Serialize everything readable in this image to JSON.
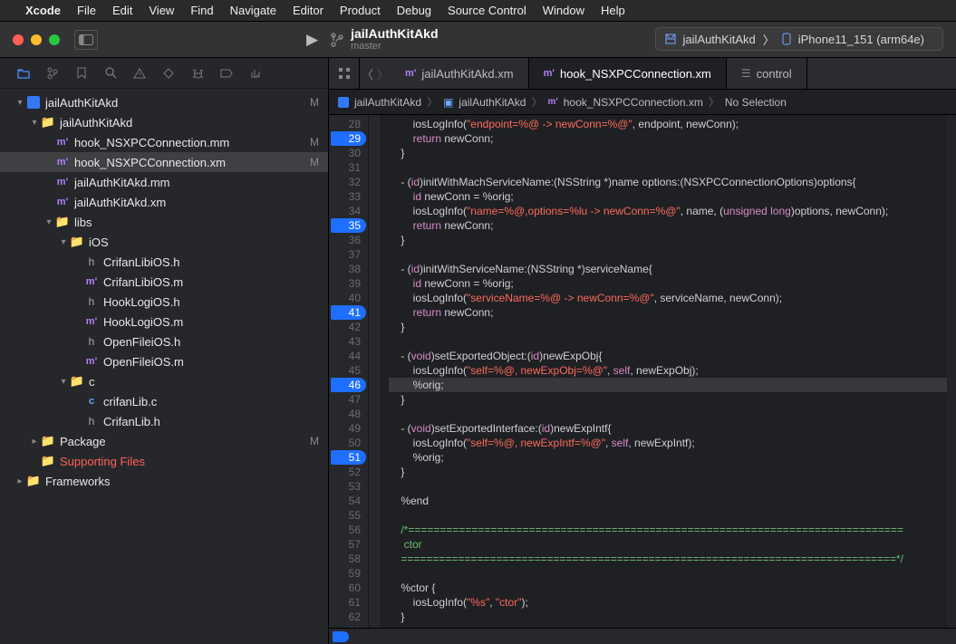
{
  "menubar": {
    "app": "Xcode",
    "items": [
      "File",
      "Edit",
      "View",
      "Find",
      "Navigate",
      "Editor",
      "Product",
      "Debug",
      "Source Control",
      "Window",
      "Help"
    ]
  },
  "titlebar": {
    "project": "jailAuthKitAkd",
    "branch": "master",
    "scheme": "jailAuthKitAkd",
    "device": "iPhone11_151 (arm64e)"
  },
  "navTabs": [
    "folder",
    "scm",
    "bookmark",
    "search",
    "warn",
    "diamond",
    "bug",
    "break",
    "log"
  ],
  "tree": [
    {
      "d": 0,
      "a": "▾",
      "icon": "proj",
      "label": "jailAuthKitAkd",
      "status": "M"
    },
    {
      "d": 1,
      "a": "▾",
      "icon": "fold",
      "label": "jailAuthKitAkd"
    },
    {
      "d": 2,
      "a": "",
      "icon": "m",
      "label": "hook_NSXPCConnection.mm",
      "status": "M"
    },
    {
      "d": 2,
      "a": "",
      "icon": "m",
      "label": "hook_NSXPCConnection.xm",
      "status": "M",
      "sel": true
    },
    {
      "d": 2,
      "a": "",
      "icon": "m",
      "label": "jailAuthKitAkd.mm"
    },
    {
      "d": 2,
      "a": "",
      "icon": "m",
      "label": "jailAuthKitAkd.xm"
    },
    {
      "d": 2,
      "a": "▾",
      "icon": "fold",
      "label": "libs"
    },
    {
      "d": 3,
      "a": "▾",
      "icon": "fold",
      "label": "iOS"
    },
    {
      "d": 4,
      "a": "",
      "icon": "h",
      "label": "CrifanLibiOS.h"
    },
    {
      "d": 4,
      "a": "",
      "icon": "m",
      "label": "CrifanLibiOS.m"
    },
    {
      "d": 4,
      "a": "",
      "icon": "h",
      "label": "HookLogiOS.h"
    },
    {
      "d": 4,
      "a": "",
      "icon": "m",
      "label": "HookLogiOS.m"
    },
    {
      "d": 4,
      "a": "",
      "icon": "h",
      "label": "OpenFileiOS.h"
    },
    {
      "d": 4,
      "a": "",
      "icon": "m",
      "label": "OpenFileiOS.m"
    },
    {
      "d": 3,
      "a": "▾",
      "icon": "fold",
      "label": "c"
    },
    {
      "d": 4,
      "a": "",
      "icon": "c",
      "label": "crifanLib.c"
    },
    {
      "d": 4,
      "a": "",
      "icon": "h",
      "label": "CrifanLib.h"
    },
    {
      "d": 1,
      "a": "▸",
      "icon": "fold",
      "label": "Package",
      "status": "M"
    },
    {
      "d": 1,
      "a": "",
      "icon": "fold",
      "label": "Supporting Files",
      "red": true
    },
    {
      "d": 0,
      "a": "▸",
      "icon": "fold",
      "label": "Frameworks"
    }
  ],
  "editorTabs": [
    {
      "icon": "m",
      "label": "jailAuthKitAkd.xm"
    },
    {
      "icon": "m",
      "label": "hook_NSXPCConnection.xm",
      "active": true
    },
    {
      "icon": "ctl",
      "label": "control"
    }
  ],
  "jumpbar": {
    "items": [
      "jailAuthKitAkd",
      "jailAuthKitAkd",
      "hook_NSXPCConnection.xm",
      "No Selection"
    ]
  },
  "code": {
    "start": 28,
    "breakpoints": [
      29,
      35,
      41,
      46,
      51
    ],
    "highlight": 46,
    "lines": [
      "        iosLogInfo(<s>\"endpoint=%@ -> newConn=%@\"</s>, endpoint, newConn);",
      "        <k>return</k> newConn;",
      "    }",
      "",
      "    - (<i>id</i>)initWithMachServiceName:(NSString *)name options:(NSXPCConnectionOptions)options{",
      "        <i>id</i> newConn = %orig;",
      "        iosLogInfo(<s>\"name=%@,options=%lu -> newConn=%@\"</s>, name, (<t>unsigned long</t>)options, newConn);",
      "        <k>return</k> newConn;",
      "    }",
      "",
      "    - (<i>id</i>)initWithServiceName:(NSString *)serviceName{",
      "        <i>id</i> newConn = %orig;",
      "        iosLogInfo(<s>\"serviceName=%@ -> newConn=%@\"</s>, serviceName, newConn);",
      "        <k>return</k> newConn;",
      "    }",
      "",
      "    - (<t>void</t>)setExportedObject:(<i>id</i>)newExpObj{",
      "        iosLogInfo(<s>\"self=%@, newExpObj=%@\"</s>, <sf>self</sf>, newExpObj);",
      "        %orig;",
      "    }",
      "",
      "    - (<t>void</t>)setExportedInterface:(<i>id</i>)newExpIntf{",
      "        iosLogInfo(<s>\"self=%@, newExpIntf=%@\"</s>, <sf>self</sf>, newExpIntf);",
      "        %orig;",
      "    }",
      "",
      "    %end",
      "",
      "    <c>/*==============================================================================</c>",
      "    <c> ctor</c>",
      "    <c>==============================================================================*/</c>",
      "",
      "    %ctor {",
      "        iosLogInfo(<s>\"%s\"</s>, <s>\"ctor\"</s>);",
      "    }",
      ""
    ]
  }
}
